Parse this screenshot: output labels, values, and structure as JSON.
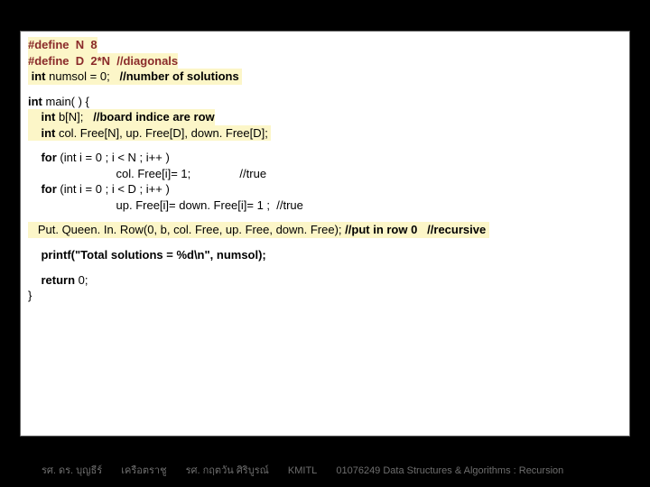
{
  "code": {
    "l1a": "#define  N  8",
    "l1b": "#define  D  2*N  //diagonals",
    "l1c": " int numsol = 0;   //number of solutions ",
    "l2a": "int",
    "l2b": " main( ) {",
    "l3a": "    int b[N];   //board indice are row",
    "l3b": "    int col. Free[N], up. Free[D], down. Free[D]; ",
    "l4a": "    for ",
    "l4b": "(int i = 0 ; i < N ; i++ )",
    "l4c": "                           col. Free[i]= 1;               //true",
    "l5a": "    for ",
    "l5b": "(int i = 0 ; i < D ; i++ )",
    "l5c": "                           up. Free[i]= down. Free[i]= 1 ;  //true",
    "l6": "   Put. Queen. In. Row(0, b, col. Free, up. Free, down. Free); //put in row 0   //recursive ",
    "l7": "    printf(\"Total solutions = %d\\n\", numsol);",
    "l8a": "    return ",
    "l8b": "0;",
    "l9": "}"
  },
  "footer": {
    "f1": "รศ. ดร. บุญธีร์",
    "f2": "เครือตราชู",
    "f3": "รศ. กฤตวัน   ศิริบูรณ์",
    "f4": "KMITL",
    "f5": "01076249 Data Structures & Algorithms : Recursion"
  }
}
